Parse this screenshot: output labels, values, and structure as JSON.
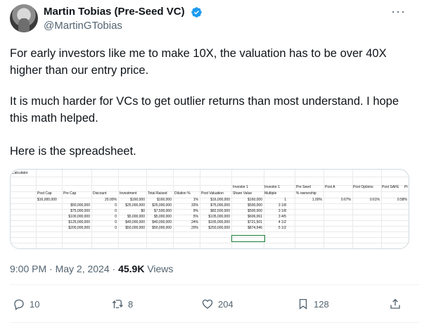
{
  "author": {
    "name": "Martin Tobias (Pre-Seed VC)",
    "handle": "@MartinGTobias",
    "verified_color": "#1d9bf0"
  },
  "more_label": "···",
  "tweet": {
    "paragraphs": [
      "For early investors like me to make 10X, the valuation has to be over 40X higher than our entry price.",
      "It is much harder for VCs to get outlier returns than most understand.  I hope this math helped.",
      "Here is the spreadsheet."
    ]
  },
  "spreadsheet": {
    "title": "Calculator",
    "header_row1": {
      "investor1_share": "Investor 1",
      "investor1_mult": "Investor 1",
      "preseed": "Pre Seed",
      "post_a": "Post A",
      "post_options": "Post Options",
      "post_safe": "Post SAFE",
      "extra": "Pr"
    },
    "header_row2": {
      "post_cap": "Post Cap",
      "pre_cap": "Pre Cap",
      "discount": "Discount",
      "investment": "Investment",
      "total_raised": "Total Raised",
      "dilution": "Dilution %",
      "post_valuation": "Post Valuation",
      "share_value": "Share Value",
      "multiple": "Multiple",
      "ownership": "% ownership"
    },
    "first_row": {
      "post_cap": "$16,000,000",
      "discount": "20.00%",
      "investment": "$160,000",
      "total_raised": "$160,000",
      "dilution": "1%",
      "post_valuation": "$16,000,000",
      "share_value": "$160,000",
      "multiple": "1",
      "preseed": "1.00%",
      "post_a": "0.67%",
      "post_options": "0.61%",
      "post_safe": "0.58%"
    },
    "rows": [
      {
        "pre_cap": "$50,000,000",
        "discount": "0",
        "investment": "$25,000,000",
        "total_raised": "$25,000,000",
        "dilution": "33%",
        "post_valuation": "$75,000,000",
        "share_value": "$500,000",
        "multiple": "3 1/8"
      },
      {
        "pre_cap": "$75,000,000",
        "discount": "0",
        "investment": "$0",
        "total_raised": "$7,500,000",
        "dilution": "9%",
        "post_valuation": "$82,500,000",
        "share_value": "$500,000",
        "multiple": "3 1/8"
      },
      {
        "pre_cap": "$100,000,000",
        "discount": "0",
        "investment": "$5,000,000",
        "total_raised": "$5,000,000",
        "dilution": "5%",
        "post_valuation": "$105,000,000",
        "share_value": "$606,061",
        "multiple": "3 4/5"
      },
      {
        "pre_cap": "$125,000,000",
        "discount": "0",
        "investment": "$40,000,000",
        "total_raised": "$40,000,000",
        "dilution": "24%",
        "post_valuation": "$165,000,000",
        "share_value": "$721,501",
        "multiple": "4 1/2"
      },
      {
        "pre_cap": "$200,000,000",
        "discount": "0",
        "investment": "$50,000,000",
        "total_raised": "$50,000,000",
        "dilution": "20%",
        "post_valuation": "$250,000,000",
        "share_value": "$874,546",
        "multiple": "5 1/2"
      }
    ]
  },
  "meta": {
    "time": "9:00 PM · May 2, 2024 · ",
    "views_count": "45.9K",
    "views_label": " Views"
  },
  "actions": {
    "replies": "10",
    "reposts": "8",
    "likes": "204",
    "bookmarks": "128"
  }
}
